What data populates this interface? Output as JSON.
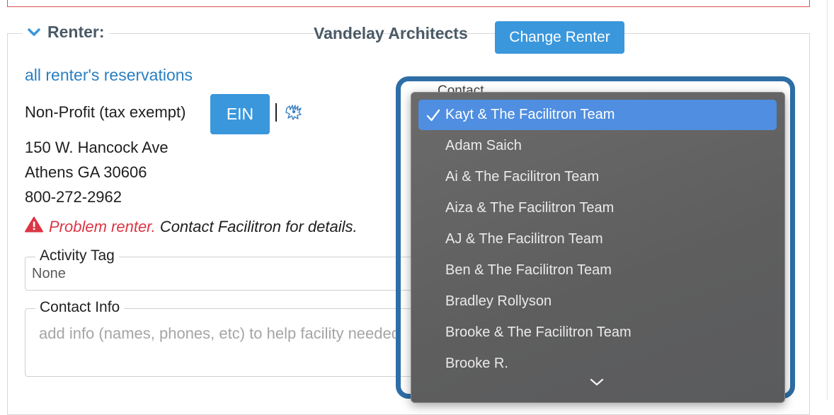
{
  "renter": {
    "section_label": "Renter:",
    "name": "Vandelay Architects",
    "change_button": "Change Renter",
    "all_reservations_link": "all renter's reservations",
    "tax_status": "Non-Profit (tax exempt)",
    "ein_button": "EIN",
    "address_line1": "150 W. Hancock Ave",
    "address_line2": "Athens GA 30606",
    "phone": "800-272-2962",
    "problem_label": "Problem renter.",
    "problem_detail": "Contact Facilitron for details."
  },
  "activity_tag": {
    "label": "Activity Tag",
    "value": "None"
  },
  "contact_info": {
    "label": "Contact Info",
    "placeholder": "add info (names, phones, etc) to help facility needed"
  },
  "contact_select": {
    "label": "Contact",
    "options": [
      "Kayt & The Facilitron Team",
      "Adam Saich",
      "Ai & The Facilitron Team",
      "Aiza & The Facilitron Team",
      "AJ & The Facilitron Team",
      "Ben & The Facilitron Team",
      "Bradley Rollyson",
      "Brooke & The Facilitron Team",
      "Brooke R."
    ],
    "selected": "Kayt & The Facilitron Team"
  },
  "colors": {
    "accent_button": "#3a97dc",
    "link": "#2a7fc1",
    "danger": "#dc3545",
    "focus_ring": "#2e6ea6",
    "menu_highlight": "#4f8ee0"
  },
  "icons": {
    "collapse": "chevron-down-icon",
    "irs": "irs-eagle-icon",
    "warning": "warning-triangle-icon",
    "check": "checkmark-icon",
    "scroll_more": "chevron-down-icon"
  }
}
